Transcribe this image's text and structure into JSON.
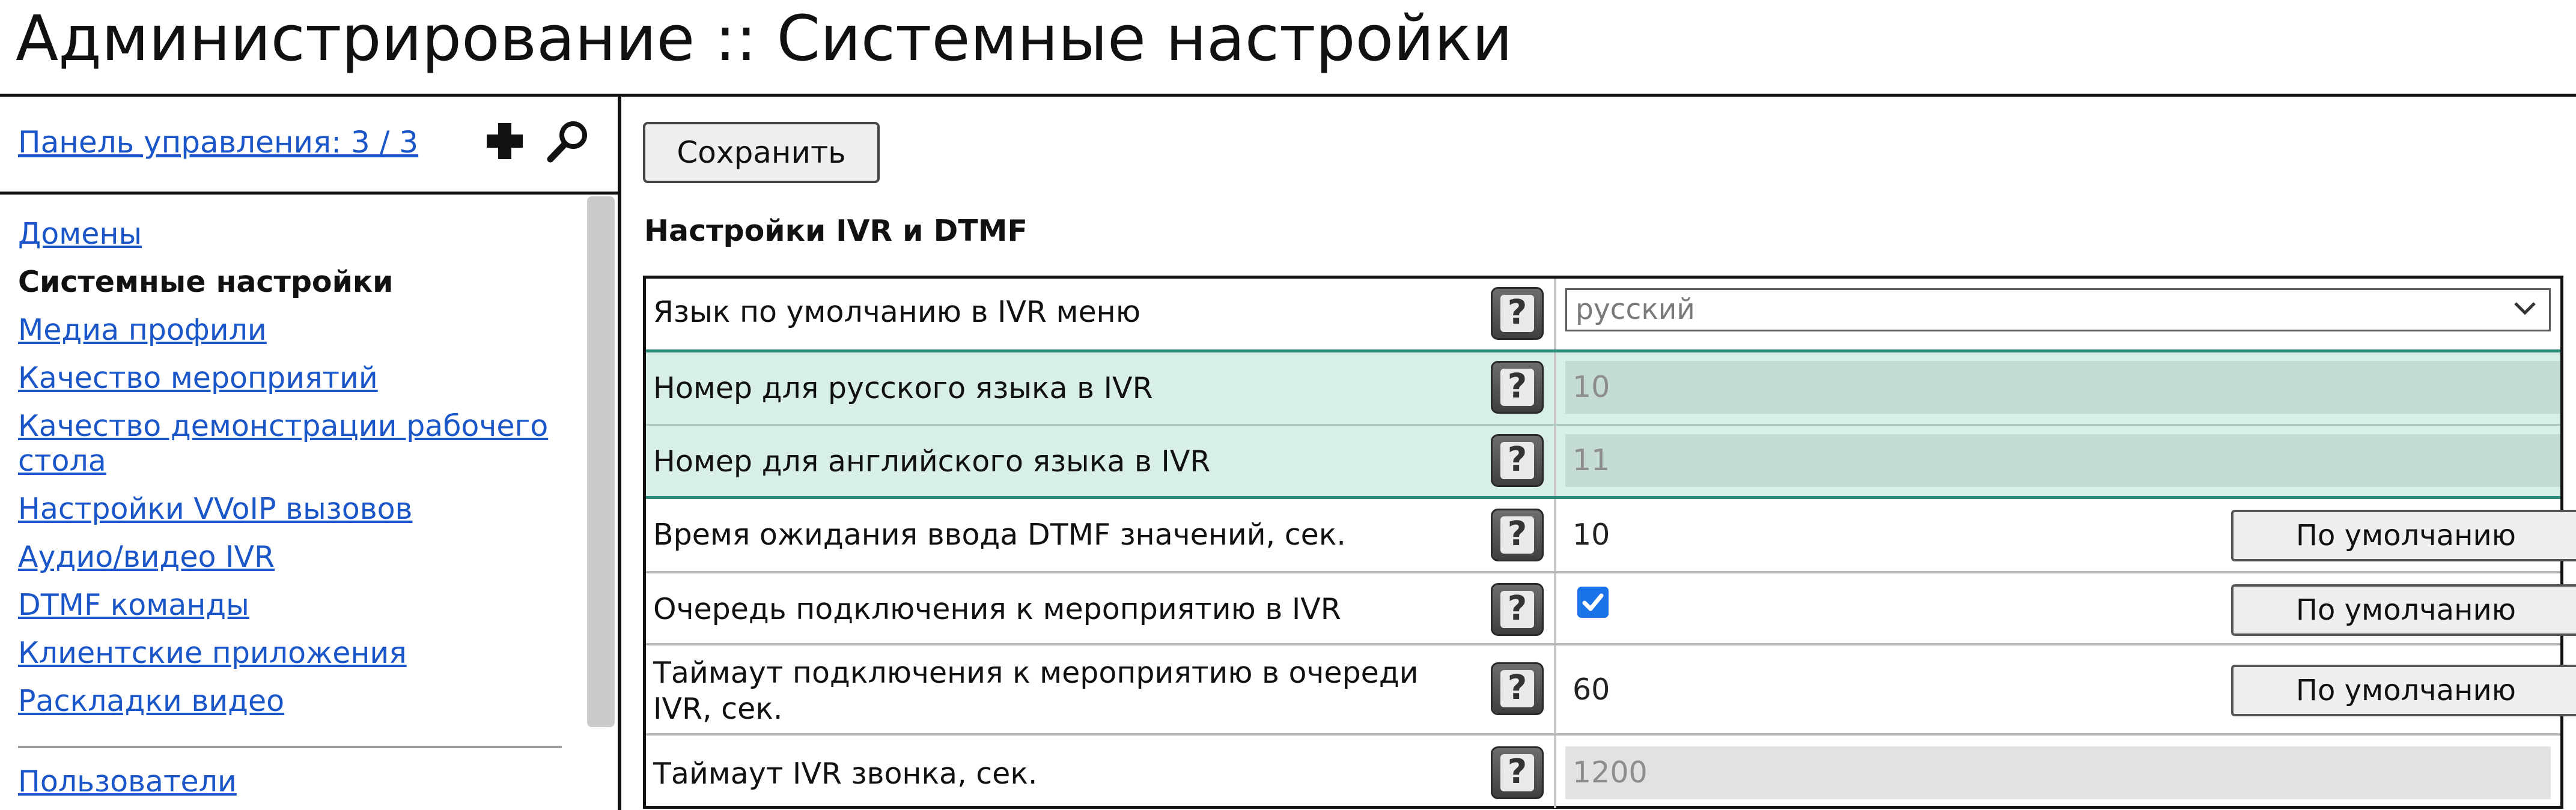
{
  "header": {
    "title": "Администрирование :: Системные настройки"
  },
  "sidebar": {
    "panel_link": "Панель управления: 3 / 3",
    "items": [
      {
        "label": "Домены",
        "active": false
      },
      {
        "label": "Системные настройки",
        "active": true
      },
      {
        "label": "Медиа профили",
        "active": false
      },
      {
        "label": "Качество мероприятий",
        "active": false
      },
      {
        "label": "Качество демонстрации рабочего стола",
        "active": false
      },
      {
        "label": "Настройки VVoIP вызовов",
        "active": false
      },
      {
        "label": "Аудио/видео IVR",
        "active": false
      },
      {
        "label": "DTMF команды",
        "active": false
      },
      {
        "label": "Клиентские приложения",
        "active": false
      },
      {
        "label": "Раскладки видео",
        "active": false
      }
    ],
    "bottom_item": "Пользователи",
    "icons": [
      "plus-icon",
      "search-icon"
    ]
  },
  "main": {
    "save_label": "Сохранить",
    "section_title": "Настройки IVR и DTMF",
    "rows": [
      {
        "label": "Язык по умолчанию в IVR меню",
        "type": "select",
        "value": "русский"
      },
      {
        "label": "Номер для русского языка в IVR",
        "type": "disabled",
        "value": "10"
      },
      {
        "label": "Номер для английского языка в IVR",
        "type": "disabled",
        "value": "11"
      },
      {
        "label": "Время ожидания ввода DTMF значений, сек.",
        "type": "input",
        "value": "10",
        "default_label": "По умолчанию"
      },
      {
        "label": "Очередь подключения к мероприятию в IVR",
        "type": "checkbox",
        "checked": true,
        "default_label": "По умолчанию"
      },
      {
        "label": "Таймаут подключения к мероприятию в очереди IVR, сек.",
        "type": "input",
        "value": "60",
        "default_label": "По умолчанию"
      },
      {
        "label": "Таймаут IVR звонка, сек.",
        "type": "disabled",
        "value": "1200"
      }
    ],
    "help_glyph": "?"
  },
  "colors": {
    "link": "#1a56c8",
    "highlight_bg": "#d8efe8",
    "highlight_border": "#2a8b78",
    "checkbox": "#1a73e8"
  }
}
